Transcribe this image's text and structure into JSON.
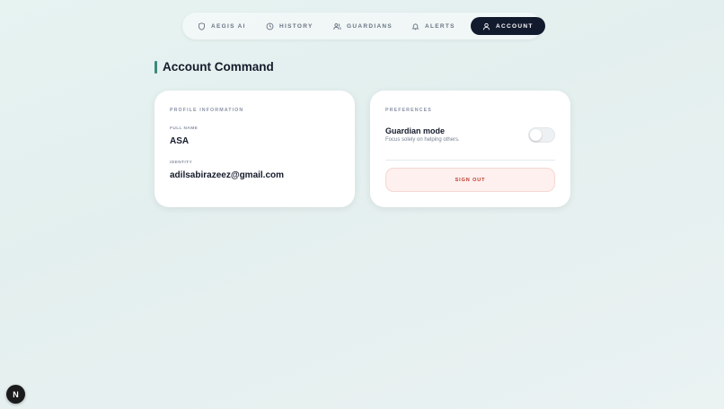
{
  "nav": {
    "items": [
      {
        "label": "AEGIS AI",
        "icon": "shield-icon"
      },
      {
        "label": "HISTORY",
        "icon": "clock-icon"
      },
      {
        "label": "GUARDIANS",
        "icon": "users-icon"
      },
      {
        "label": "ALERTS",
        "icon": "bell-icon"
      },
      {
        "label": "ACCOUNT",
        "icon": "user-icon",
        "active": true
      }
    ]
  },
  "page": {
    "title": "Account Command"
  },
  "profile": {
    "section_label": "PROFILE INFORMATION",
    "full_name_label": "FULL NAME",
    "full_name": "ASA",
    "identity_label": "IDENTITY",
    "identity": "adilsabirazeez@gmail.com"
  },
  "preferences": {
    "section_label": "PREFERENCES",
    "guardian_mode_title": "Guardian mode",
    "guardian_mode_desc": "Focus solely on helping others.",
    "guardian_mode_enabled": false,
    "sign_out_label": "SIGN OUT"
  },
  "badge": {
    "letter": "N"
  },
  "colors": {
    "accent": "#3a8a7e",
    "active_nav": "#121a2e",
    "danger": "#c0392b"
  }
}
